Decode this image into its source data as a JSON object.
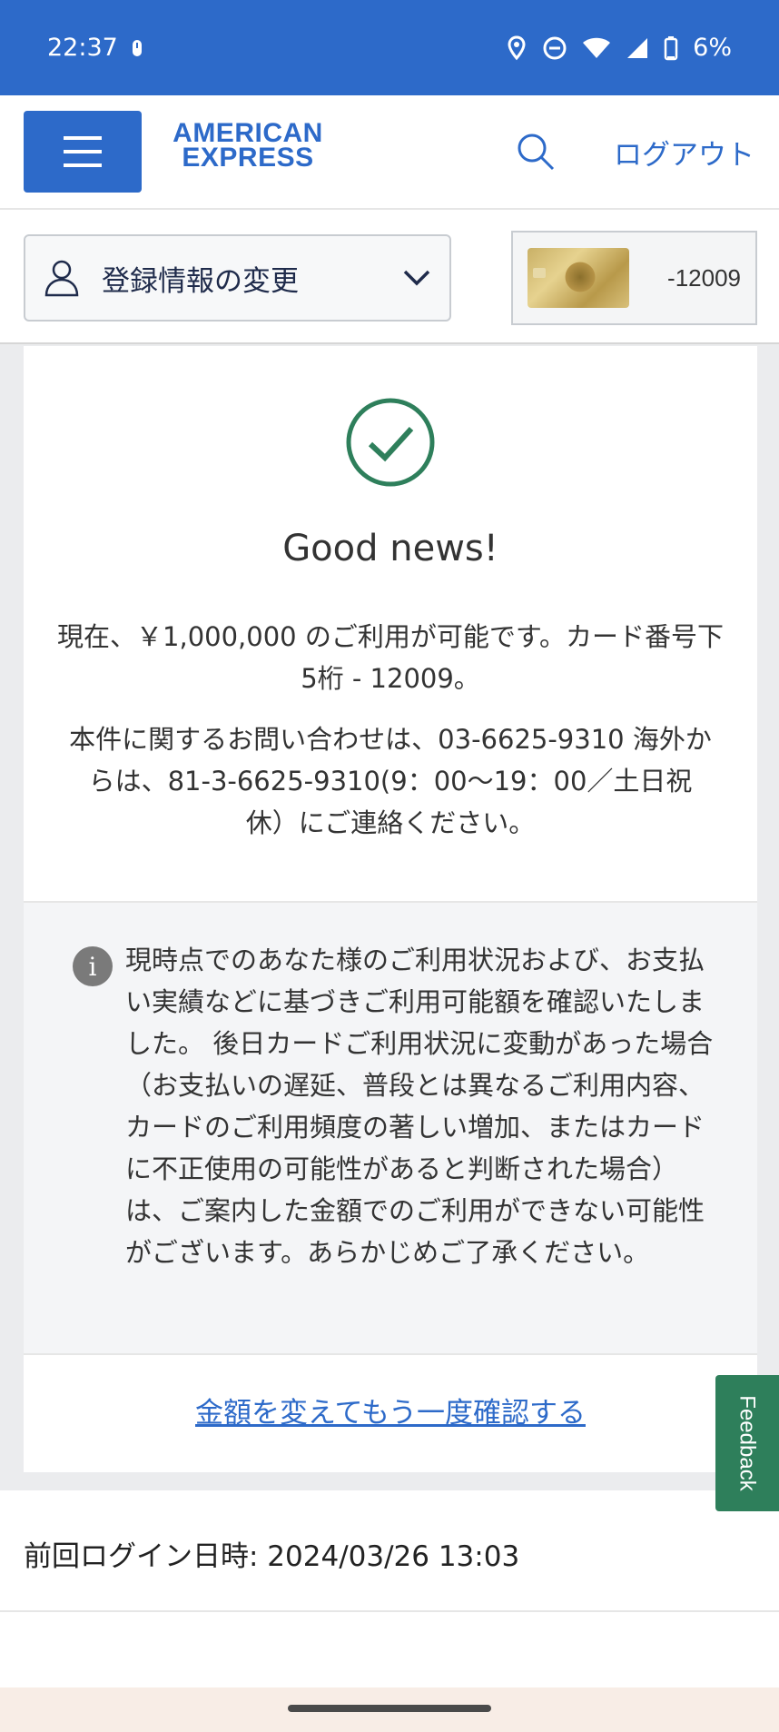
{
  "status_bar": {
    "time": "22:37",
    "battery": "6%",
    "icons": [
      "notification-icon",
      "location-icon",
      "dnd-icon",
      "wifi-icon",
      "signal-icon",
      "battery-icon"
    ]
  },
  "header": {
    "logo_line1": "AMERICAN",
    "logo_line2": "EXPRESS",
    "logout_label": "ログアウト",
    "brand_color": "#2d6ac9"
  },
  "sub_header": {
    "account_menu_label": "登録情報の変更",
    "card_number": "-12009"
  },
  "result": {
    "heading": "Good news!",
    "message_1": "現在、￥1,000,000 のご利用が可能です。カード番号下5桁 - 12009。",
    "message_2": "本件に関するお問い合わせは、03-6625-9310 海外からは、81-3-6625-9310(9：00〜19：00／土日祝休）にご連絡ください。",
    "info_text": "現時点でのあなた様のご利用状況および、お支払い実績などに基づきご利用可能額を確認いたしました。 後日カードご利用状況に変動があった場合（お支払いの遅延、普段とは異なるご利用内容、カードのご利用頻度の著しい増加、またはカードに不正使用の可能性があると判断された場合）は、ご案内した金額でのご利用ができない可能性がございます。あらかじめご了承ください。",
    "recheck_link": "金額を変えてもう一度確認する",
    "success_color": "#2e7f5b"
  },
  "feedback_label": "Feedback",
  "last_login": "前回ログイン日時: 2024/03/26 13:03"
}
